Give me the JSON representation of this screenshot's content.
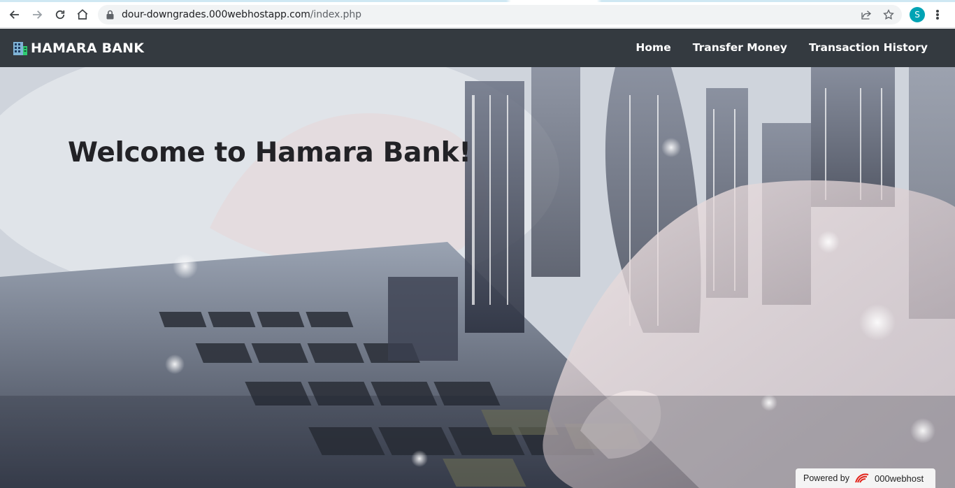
{
  "browser": {
    "url_host": "dour-downgrades.000webhostapp.com",
    "url_path": "/index.php",
    "profile_initial": "S"
  },
  "navbar": {
    "brand": "HAMARA BANK",
    "links": [
      "Home",
      "Transfer Money",
      "Transaction History"
    ]
  },
  "hero": {
    "title": "Welcome to Hamara Bank!"
  },
  "footer_badge": {
    "powered_by": "Powered by",
    "host": "000webhost"
  },
  "colors": {
    "navbar_bg": "#343a40",
    "avatar": "#00a3b4",
    "title": "#222226"
  }
}
